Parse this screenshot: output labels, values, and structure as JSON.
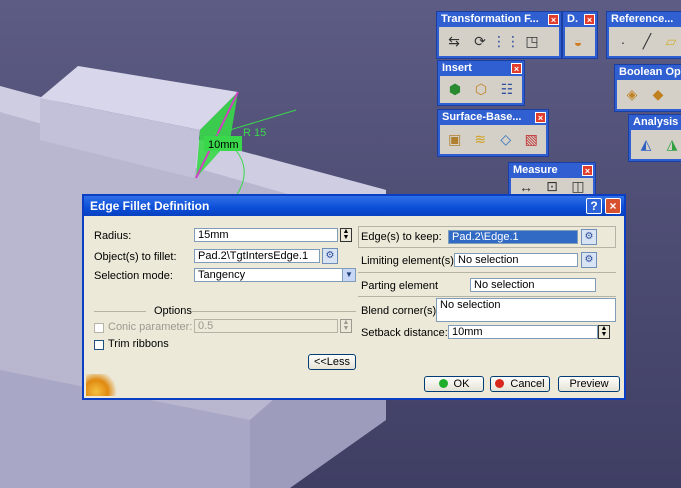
{
  "scene": {
    "dimension_label": "10mm",
    "radius_label": "R 15",
    "colors": {
      "background": "#4f4e76",
      "part_face": "#c4c2d8",
      "highlight": "#39d84a",
      "edge": "#d040c0"
    }
  },
  "toolbars": {
    "transformation": {
      "title": "Transformation F...",
      "icons": [
        "translate-icon",
        "rotate-icon",
        "pattern-icon",
        "scale-icon"
      ]
    },
    "d": {
      "title": "D.",
      "icons": [
        "dress-up-icon"
      ]
    },
    "reference": {
      "title": "Reference...",
      "icons": [
        "point-icon",
        "line-icon",
        "plane-icon"
      ]
    },
    "insert": {
      "title": "Insert",
      "icons": [
        "body-icon",
        "geometrical-set-icon",
        "tree-icon"
      ]
    },
    "boolean": {
      "title": "Boolean Op",
      "icons": [
        "assemble-icon",
        "add-icon"
      ]
    },
    "surface_based": {
      "title": "Surface-Base...",
      "icons": [
        "split-icon",
        "thick-surface-icon",
        "close-surface-icon",
        "sew-icon"
      ]
    },
    "analysis": {
      "title": "Analysis",
      "icons": [
        "draft-analysis-icon",
        "curvature-icon"
      ]
    },
    "measure": {
      "title": "Measure",
      "icons": [
        "measure-between-icon",
        "measure-item-icon",
        "inertia-icon"
      ]
    },
    "close_glyph": "×"
  },
  "dialog": {
    "title": "Edge Fillet Definition",
    "help_glyph": "?",
    "close_glyph": "×",
    "radius": {
      "label": "Radius:",
      "value": "15mm"
    },
    "objects": {
      "label": "Object(s) to fillet:",
      "value": "Pad.2\\TgtIntersEdge.1"
    },
    "selection_mode": {
      "label": "Selection mode:",
      "value": "Tangency"
    },
    "options": {
      "heading": "Options",
      "conic": {
        "label": "Conic parameter:",
        "value": "0.5",
        "checked": false,
        "enabled": false
      },
      "trim": {
        "label": "Trim ribbons",
        "checked": false
      }
    },
    "less_button": "<<Less",
    "edges_to_keep": {
      "label": "Edge(s) to keep:",
      "value": "Pad.2\\Edge.1"
    },
    "limiting": {
      "label": "Limiting element(s):",
      "value": "No selection"
    },
    "parting": {
      "label": "Parting element",
      "value": "No selection"
    },
    "blend": {
      "label": "Blend corner(s)",
      "value": "No selection"
    },
    "setback": {
      "label": "Setback distance:",
      "value": "10mm"
    },
    "ok_button": "OK",
    "cancel_button": "Cancel",
    "preview_button": "Preview",
    "colors": {
      "ok": "#1fae2c",
      "cancel": "#d8281c",
      "title": "#0b4fd6"
    }
  }
}
